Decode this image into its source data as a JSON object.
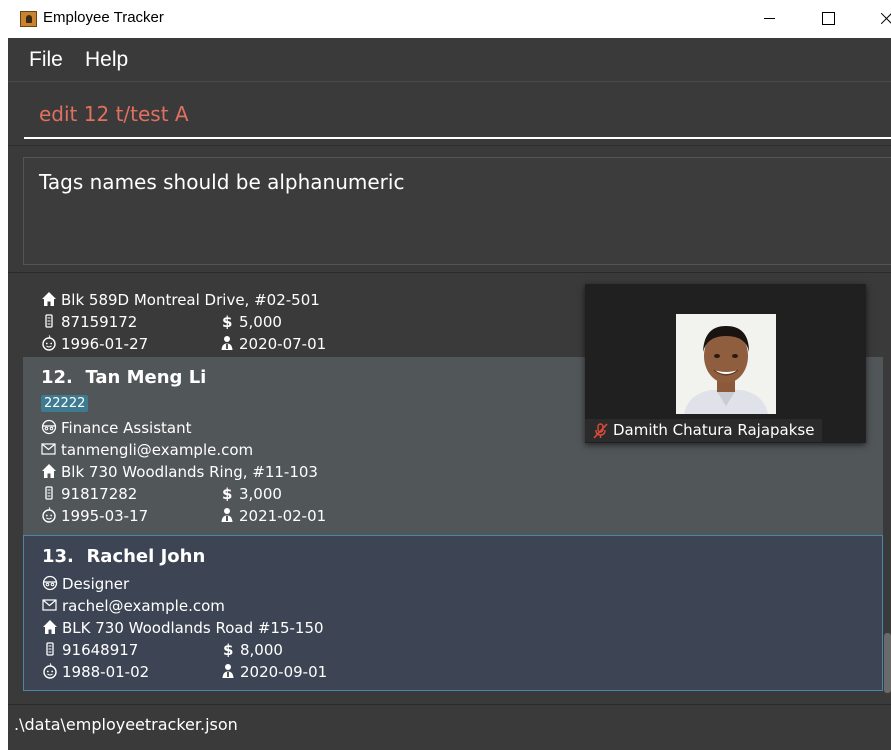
{
  "window": {
    "title": "Employee Tracker"
  },
  "menu": {
    "file": "File",
    "help": "Help"
  },
  "command": {
    "value": "edit 12 t/test A"
  },
  "result": {
    "message": "Tags names should be alphanumeric"
  },
  "employees": [
    {
      "address": "Blk 589D Montreal Drive, #02-501",
      "phone": "87159172",
      "salary": "5,000",
      "birthday": "1996-01-27",
      "start_date": "2020-07-01"
    },
    {
      "index": "12.",
      "name": "Tan Meng Li",
      "tag": "22222",
      "role": "Finance Assistant",
      "email": "tanmengli@example.com",
      "address": "Blk 730 Woodlands Ring, #11-103",
      "phone": "91817282",
      "salary": "3,000",
      "birthday": "1995-03-17",
      "start_date": "2021-02-01"
    },
    {
      "index": "13.",
      "name": "Rachel John",
      "role": "Designer",
      "email": "rachel@example.com",
      "address": "BLK 730 Woodlands Road #15-150",
      "phone": "91648917",
      "salary": "8,000",
      "birthday": "1988-01-02",
      "start_date": "2020-09-01"
    }
  ],
  "video": {
    "participant_name": "Damith Chatura Rajapakse"
  },
  "status": {
    "file_path": ".\\data\\employeetracker.json"
  },
  "icons": {
    "address": "home-icon",
    "phone": "phone-icon",
    "salary": "dollar-icon",
    "birthday": "birthday-icon",
    "start_date": "person-icon",
    "role": "role-icon",
    "email": "email-icon",
    "mic": "mic-off-icon"
  },
  "colors": {
    "background": "#3a3a3a",
    "command_text": "#e07060",
    "selected_card": "#3d4554",
    "selected_border": "#4b85a8",
    "hover_card": "#515658",
    "tag": "#3e7b91"
  }
}
